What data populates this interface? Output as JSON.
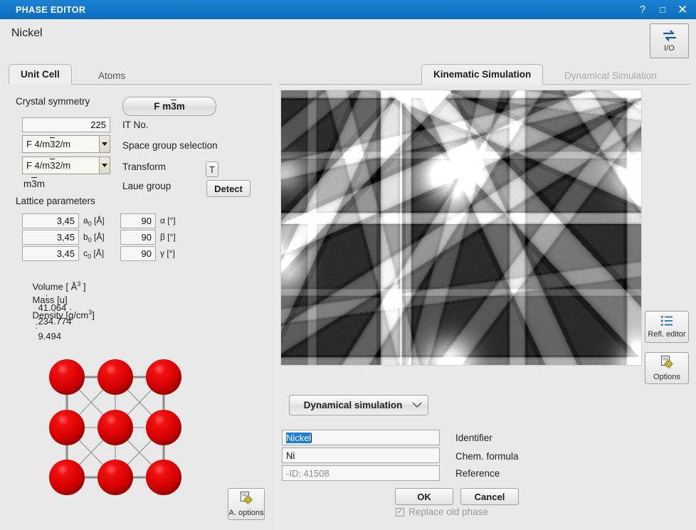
{
  "window": {
    "title": "PHASE EDITOR",
    "help_label": "?",
    "maximize_label": "□",
    "close_label": "✕"
  },
  "header": {
    "phase_name": "Nickel",
    "io_button_label": "I/O",
    "io_icon": "exchange-arrows-icon"
  },
  "left_tabs": [
    {
      "label": "Unit Cell",
      "state": "active"
    },
    {
      "label": "Atoms",
      "state": "inactive"
    }
  ],
  "right_tabs": [
    {
      "label": "Kinematic Simulation",
      "state": "active"
    },
    {
      "label": "Dynamical Simulation",
      "state": "disabled"
    }
  ],
  "crystal_symmetry": {
    "section_title": "Crystal symmetry",
    "symmetry_button": {
      "prefix": "F m",
      "bar": "3",
      "suffix": "m"
    },
    "it_no_value": "225",
    "it_no_label": "IT No.",
    "space_group_value": {
      "prefix": "F 4/m",
      "bar": "3",
      "suffix": "2/m"
    },
    "space_group_label": "Space group selection",
    "transform_value": {
      "prefix": "F 4/m",
      "bar": "3",
      "suffix": "2/m"
    },
    "transform_label": "Transform",
    "transform_button": "T",
    "laue_value": {
      "prefix": "m",
      "bar": "3",
      "suffix": "m"
    },
    "laue_label": "Laue group",
    "detect_button": "Detect"
  },
  "lattice": {
    "section_title": "Lattice parameters",
    "rows": [
      {
        "length_value": "3,45",
        "length_label": "a",
        "length_sub": "0",
        "length_unit": "[Å]",
        "angle_value": "90",
        "angle_label": "α",
        "angle_unit": "[°]"
      },
      {
        "length_value": "3,45",
        "length_label": "b",
        "length_sub": "0",
        "length_unit": "[Å]",
        "angle_value": "90",
        "angle_label": "β",
        "angle_unit": "[°]"
      },
      {
        "length_value": "3,45",
        "length_label": "c",
        "length_sub": "0",
        "length_unit": "[Å]",
        "angle_value": "90",
        "angle_label": "γ",
        "angle_unit": "[°]"
      }
    ],
    "volume_label": "Volume [ Å",
    "volume_exp": "3",
    "volume_label_end": " ]",
    "volume_sep": ":",
    "volume_value": "41.064",
    "mass_label": "Mass [u]",
    "mass_sep": ":",
    "mass_value": "234.774",
    "density_label": "Density [g/cm",
    "density_exp": "3",
    "density_label_end": "]",
    "density_sep": ":",
    "density_value": "9.494"
  },
  "crystal_view": {
    "name": "unit-cell-preview",
    "atom_color": "#e00000",
    "bond_color": "#8c8c8c",
    "background": "#e9e9e9"
  },
  "atom_options_button": {
    "label": "A. options",
    "icon": "settings-document-icon"
  },
  "simulation": {
    "pattern_name": "kikuchi-pattern",
    "refl_editor_button": {
      "label": "Refl. editor",
      "icon": "list-icon"
    },
    "options_button": {
      "label": "Options",
      "icon": "settings-document-icon"
    },
    "mode_combo": {
      "value": "Dynamical simulation",
      "chevron": "⌄"
    }
  },
  "form": {
    "identifier": {
      "value": "Nickel",
      "label": "Identifier",
      "selected": true
    },
    "chem_formula": {
      "value": "Ni",
      "label": "Chem. formula"
    },
    "reference": {
      "placeholder": "-ID: 41508",
      "value": "",
      "label": "Reference"
    },
    "ok_button": "OK",
    "cancel_button": "Cancel",
    "replace_checkbox": {
      "label": "Replace old phase",
      "checked": true,
      "mark": "✓"
    }
  },
  "colors": {
    "titlebar": "#1277c8",
    "accent_blue": "#1a7fd4",
    "panel_bg": "#e9e9e9",
    "atom_red": "#e00000"
  }
}
